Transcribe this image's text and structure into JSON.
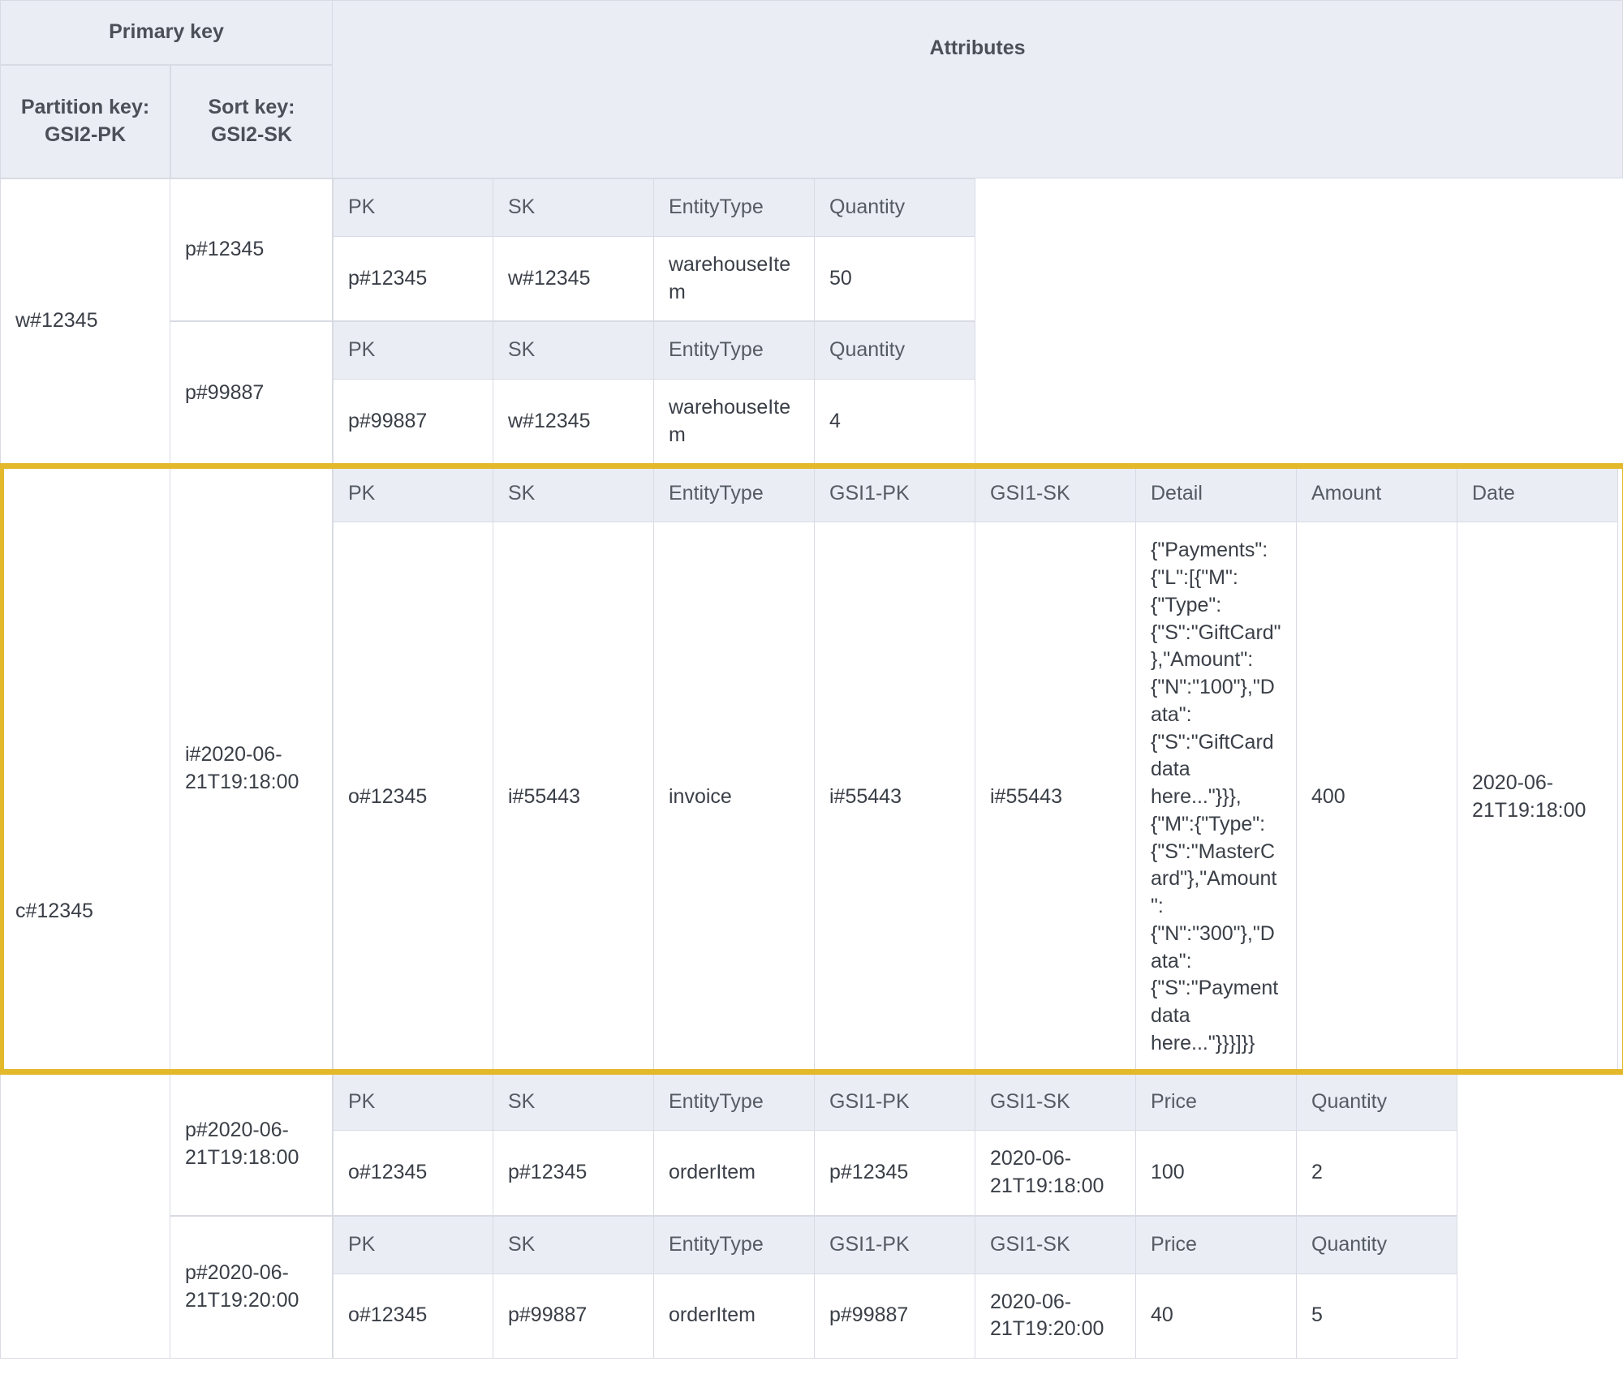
{
  "header": {
    "primary_key": "Primary key",
    "partition_label": "Partition key: GSI2-PK",
    "sort_label": "Sort key: GSI2-SK",
    "attributes": "Attributes"
  },
  "col": {
    "PK": "PK",
    "SK": "SK",
    "EntityType": "EntityType",
    "Quantity": "Quantity",
    "GSI1PK": "GSI1-PK",
    "GSI1SK": "GSI1-SK",
    "Detail": "Detail",
    "Amount": "Amount",
    "Date": "Date",
    "Price": "Price"
  },
  "partitions": [
    {
      "pk": "w#12345",
      "rows": [
        {
          "sk": "p#12345",
          "cols": [
            "PK",
            "SK",
            "EntityType",
            "Quantity"
          ],
          "vals": {
            "PK": "p#12345",
            "SK": "w#12345",
            "EntityType": "warehouseItem",
            "Quantity": "50"
          }
        },
        {
          "sk": "p#99887",
          "cols": [
            "PK",
            "SK",
            "EntityType",
            "Quantity"
          ],
          "vals": {
            "PK": "p#99887",
            "SK": "w#12345",
            "EntityType": "warehouseItem",
            "Quantity": "4"
          }
        }
      ]
    },
    {
      "pk": "c#12345",
      "rows": [
        {
          "sk": "i#2020-06-21T19:18:00",
          "cols": [
            "PK",
            "SK",
            "EntityType",
            "GSI1PK",
            "GSI1SK",
            "Detail",
            "Amount",
            "Date"
          ],
          "vals": {
            "PK": "o#12345",
            "SK": "i#55443",
            "EntityType": "invoice",
            "GSI1PK": "i#55443",
            "GSI1SK": "i#55443",
            "Detail": "{\"Payments\":{\"L\":[{\"M\":{\"Type\":{\"S\":\"GiftCard\"},\"Amount\":{\"N\":\"100\"},\"Data\":{\"S\":\"GiftCard data here...\"}}},{\"M\":{\"Type\":{\"S\":\"MasterCard\"},\"Amount\":{\"N\":\"300\"},\"Data\":{\"S\":\"Payment data here...\"}}}]}}",
            "Amount": "400",
            "Date": "2020-06-21T19:18:00"
          },
          "highlight": true
        },
        {
          "sk": "p#2020-06-21T19:18:00",
          "cols": [
            "PK",
            "SK",
            "EntityType",
            "GSI1PK",
            "GSI1SK",
            "Price",
            "Quantity"
          ],
          "vals": {
            "PK": "o#12345",
            "SK": "p#12345",
            "EntityType": "orderItem",
            "GSI1PK": "p#12345",
            "GSI1SK": "2020-06-21T19:18:00",
            "Price": "100",
            "Quantity": "2"
          }
        },
        {
          "sk": "p#2020-06-21T19:20:00",
          "cols": [
            "PK",
            "SK",
            "EntityType",
            "GSI1PK",
            "GSI1SK",
            "Price",
            "Quantity"
          ],
          "vals": {
            "PK": "o#12345",
            "SK": "p#99887",
            "EntityType": "orderItem",
            "GSI1PK": "p#99887",
            "GSI1SK": "2020-06-21T19:20:00",
            "Price": "40",
            "Quantity": "5"
          }
        }
      ]
    }
  ]
}
